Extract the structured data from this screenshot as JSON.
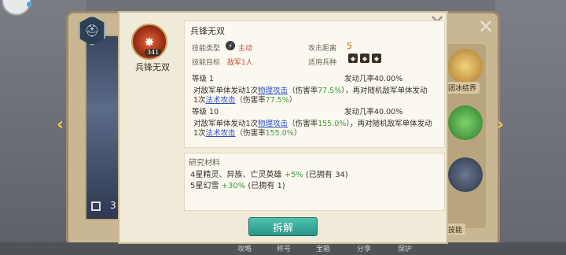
{
  "skill": {
    "name": "兵锋无双",
    "icon": "flame-burst-icon",
    "icon_badge": "341"
  },
  "info": {
    "type_label": "技能类型",
    "type_value": "主动",
    "type_icon": "active-skill-icon",
    "distance_label": "攻击距离",
    "distance_value": "5",
    "target_label": "技能目标",
    "target_value": "敌军1人",
    "troop_label": "适用兵种",
    "troop_icons": [
      "cavalry-icon",
      "infantry-icon",
      "archer-icon"
    ]
  },
  "levels": [
    {
      "level_label": "等级 1",
      "rate_label": "发动几率40.00%",
      "line1_a": "对敌军单体发动1次",
      "line1_link": "物理攻击",
      "line1_b": "（伤害率",
      "line1_pct": "77.5%",
      "line1_c": "），再对随机敌军单体发动",
      "line2_a": "1次",
      "line2_link": "法术攻击",
      "line2_b": "（伤害率",
      "line2_pct": "77.5%",
      "line2_c": "）"
    },
    {
      "level_label": "等级 10",
      "rate_label": "发动几率40.00%",
      "line1_a": "对敌军单体发动1次",
      "line1_link": "物理攻击",
      "line1_b": "（伤害率",
      "line1_pct": "155.0%",
      "line1_c": "），再对随机敌军单体发动",
      "line2_a": "1次",
      "line2_link": "法术攻击",
      "line2_b": "（伤害率",
      "line2_pct": "155.0%",
      "line2_c": "）"
    }
  ],
  "materials": {
    "title": "研究材料",
    "rows": [
      {
        "name": "4星精灵、异族、亡灵英雄",
        "bonus": "+5%",
        "owned": "(已拥有 34)"
      },
      {
        "name": "5星幻雪",
        "bonus": "+30%",
        "owned": "(已拥有 1)"
      }
    ]
  },
  "actions": {
    "decompose_label": "拆解"
  },
  "background": {
    "hero_count": "3",
    "side_labels": [
      "团冰结界",
      "技能"
    ],
    "bottom_tabs": [
      "攻略",
      "称号",
      "宝箱",
      "分享",
      "保护"
    ]
  },
  "colors": {
    "accent_teal": "#2a9486",
    "link_blue": "#3253c8",
    "bonus_green": "#3e9a3e"
  }
}
